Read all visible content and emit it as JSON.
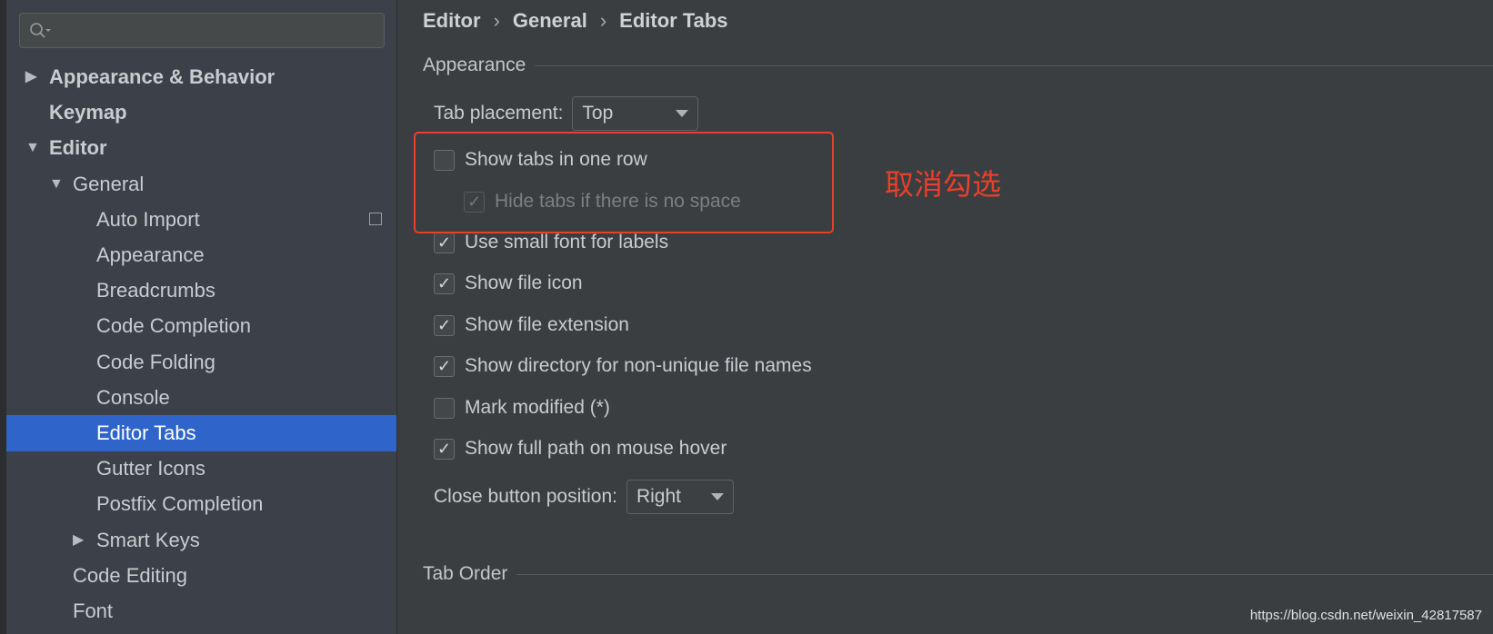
{
  "search": {
    "placeholder": ""
  },
  "sidebar": {
    "items": [
      {
        "label": "Appearance & Behavior",
        "bold": true,
        "arrow": "right"
      },
      {
        "label": "Keymap",
        "bold": true
      },
      {
        "label": "Editor",
        "bold": true,
        "arrow": "down"
      },
      {
        "label": "General",
        "arrow": "down"
      },
      {
        "label": "Auto Import",
        "icon": "copy-icon"
      },
      {
        "label": "Appearance"
      },
      {
        "label": "Breadcrumbs"
      },
      {
        "label": "Code Completion"
      },
      {
        "label": "Code Folding"
      },
      {
        "label": "Console"
      },
      {
        "label": "Editor Tabs",
        "selected": true
      },
      {
        "label": "Gutter Icons"
      },
      {
        "label": "Postfix Completion"
      },
      {
        "label": "Smart Keys",
        "arrow": "right"
      },
      {
        "label": "Code Editing"
      },
      {
        "label": "Font"
      }
    ]
  },
  "breadcrumb": [
    "Editor",
    "General",
    "Editor Tabs"
  ],
  "appearance": {
    "title": "Appearance",
    "tab_placement_label": "Tab placement:",
    "tab_placement_value": "Top",
    "options": [
      {
        "label": "Show tabs in one row",
        "checked": false
      },
      {
        "label": "Hide tabs if there is no space",
        "checked": true,
        "disabled": true
      },
      {
        "label": "Use small font for labels",
        "checked": true
      },
      {
        "label": "Show file icon",
        "checked": true
      },
      {
        "label": "Show file extension",
        "checked": true
      },
      {
        "label": "Show directory for non-unique file names",
        "checked": true
      },
      {
        "label": "Mark modified (*)",
        "checked": false
      },
      {
        "label": "Show full path on mouse hover",
        "checked": true
      }
    ],
    "close_button_label": "Close button position:",
    "close_button_value": "Right"
  },
  "tab_order": {
    "title": "Tab Order"
  },
  "annotation": {
    "text": "取消勾选",
    "color": "#e8402a"
  },
  "watermark": "https://blog.csdn.net/weixin_42817587",
  "colors": {
    "selection": "#2f65ca"
  }
}
